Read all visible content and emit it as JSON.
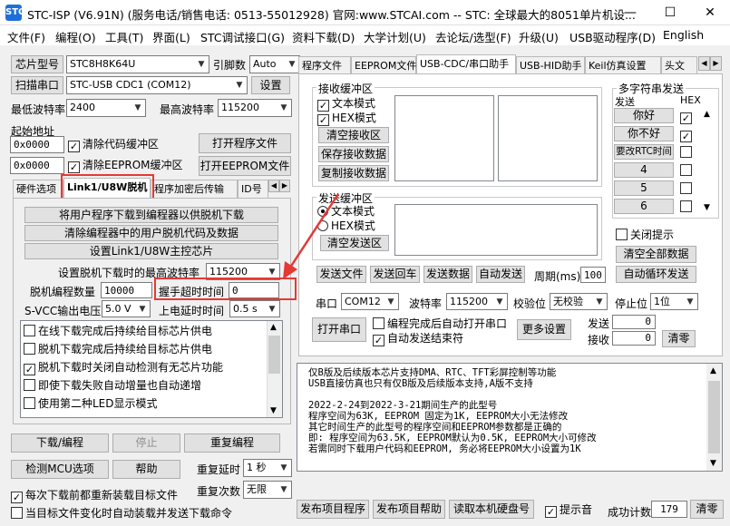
{
  "window": {
    "title": "STC-ISP (V6.91N) (服务电话/销售电话: 0513-55012928) 官网:www.STCAI.com  -- STC: 全球最大的8051单片机设...",
    "app_icon_label": "STC",
    "minimize": "—",
    "maximize": "☐",
    "close": "✕"
  },
  "menu": [
    "文件(F)",
    "编程(O)",
    "工具(T)",
    "界面(L)",
    "STC调试接口(G)",
    "资料下载(D)",
    "大学计划(U)",
    "去论坛/选型(F)",
    "升级(U)",
    "USB驱动程序(D)",
    "English"
  ],
  "left": {
    "chip_button": "芯片型号",
    "chip_value": "STC8H8K64U",
    "pins_label": "引脚数",
    "pins_value": "Auto",
    "scan_button": "扫描串口",
    "port_value": "STC-USB CDC1 (COM12)",
    "settings_button": "设置",
    "min_baud_label": "最低波特率",
    "min_baud_value": "2400",
    "max_baud_label": "最高波特率",
    "max_baud_value": "115200",
    "start_addr_label": "起始地址",
    "addr1": "0x0000",
    "clear_code": "清除代码缓冲区",
    "open_prog": "打开程序文件",
    "addr2": "0x0000",
    "clear_eeprom": "清除EEPROM缓冲区",
    "open_eeprom": "打开EEPROM文件",
    "tabs": [
      "硬件选项",
      "Link1/U8W脱机",
      "程序加密后传输",
      "ID号"
    ],
    "offline": {
      "btn1": "将用户程序下载到编程器以供脱机下载",
      "btn2": "清除编程器中的用户脱机代码及数据",
      "btn3": "设置Link1/U8W主控芯片",
      "max_baud_label": "设置脱机下载时的最高波特率",
      "max_baud_value": "115200",
      "count_label": "脱机编程数量",
      "count_value": "10000",
      "handshake_label": "握手超时时间",
      "handshake_value": "0",
      "svcc_label": "S-VCC输出电压",
      "svcc_value": "5.0 V",
      "delay_label": "上电延时时间",
      "delay_value": "0.5 s",
      "options": [
        {
          "label": "在线下载完成后持续给目标芯片供电",
          "checked": false
        },
        {
          "label": "脱机下载完成后持续给目标芯片供电",
          "checked": false
        },
        {
          "label": "脱机下载时关闭自动检测有无芯片功能",
          "checked": true
        },
        {
          "label": "即使下载失败自动增量也自动递增",
          "checked": false
        },
        {
          "label": "使用第二种LED显示模式",
          "checked": false
        }
      ]
    },
    "download_btn": "下载/编程",
    "stop_btn": "停止",
    "reprogram_btn": "重复编程",
    "detect_btn": "检测MCU选项",
    "help_btn": "帮助",
    "repeat_delay_label": "重复延时",
    "repeat_delay_value": "1 秒",
    "repeat_count_label": "重复次数",
    "repeat_count_value": "无限",
    "reload_each": "每次下载前都重新装载目标文件",
    "auto_reload": "当目标文件变化时自动装载并发送下载命令"
  },
  "right": {
    "tabs": [
      "程序文件",
      "EEPROM文件",
      "USB-CDC/串口助手",
      "USB-HID助手",
      "Keil仿真设置",
      "头文"
    ],
    "recv_label": "接收缓冲区",
    "recv_text_mode": "文本模式",
    "recv_hex_mode": "HEX模式",
    "clear_recv": "清空接收区",
    "save_recv": "保存接收数据",
    "copy_recv": "复制接收数据",
    "send_label": "发送缓冲区",
    "send_text_mode": "文本模式",
    "send_hex_mode": "HEX模式",
    "clear_send": "清空发送区",
    "multi_label": "多字符串发送",
    "multi_send_col": "发送",
    "multi_hex_col": "HEX",
    "multi_items": [
      {
        "label": "你好",
        "hex": true
      },
      {
        "label": "你不好",
        "hex": true
      },
      {
        "label": "要改RTC时间",
        "hex": false
      },
      {
        "label": "4",
        "hex": false
      },
      {
        "label": "5",
        "hex": false
      },
      {
        "label": "6",
        "hex": false
      }
    ],
    "close_hint": "关闭提示",
    "clear_all": "清空全部数据",
    "auto_loop": "自动循环发送",
    "send_file": "发送文件",
    "send_cr": "发送回车",
    "send_data": "发送数据",
    "auto_send": "自动发送",
    "period_label": "周期(ms)",
    "period_value": "100",
    "port_label": "串口",
    "port_value": "COM12",
    "baud_label": "波特率",
    "baud_value": "115200",
    "parity_label": "校验位",
    "parity_value": "无校验",
    "stop_label": "停止位",
    "stop_value": "1位",
    "open_port": "打开串口",
    "auto_open": "编程完成后自动打开串口",
    "auto_end": "自动发送结束符",
    "more_settings": "更多设置",
    "sent_label": "发送",
    "sent_value": "0",
    "recv_count_label": "接收",
    "recv_count_value": "0",
    "clear_counts": "清零",
    "log_lines": [
      "仅B版及后续版本芯片支持DMA、RTC、TFT彩屏控制等功能",
      "USB直接仿真也只有仅B版及后续版本支持,A版不支持",
      "",
      "2022-2-24到2022-3-21期间生产的此型号",
      "程序空间为63K, EEPROM 固定为1K, EEPROM大小无法修改",
      "其它时间生产的此型号的程序空间和EEPROM参数都是正确的",
      "即: 程序空间为63.5K, EEPROM默认为0.5K, EEPROM大小可修改",
      "若需同时下载用户代码和EEPROM, 务必将EEPROM大小设置为1K"
    ],
    "publish_prog": "发布项目程序",
    "publish_help": "发布项目帮助",
    "read_serial": "读取本机硬盘号",
    "beep": "提示音",
    "success_label": "成功计数",
    "success_value": "179",
    "success_clear": "清零"
  }
}
